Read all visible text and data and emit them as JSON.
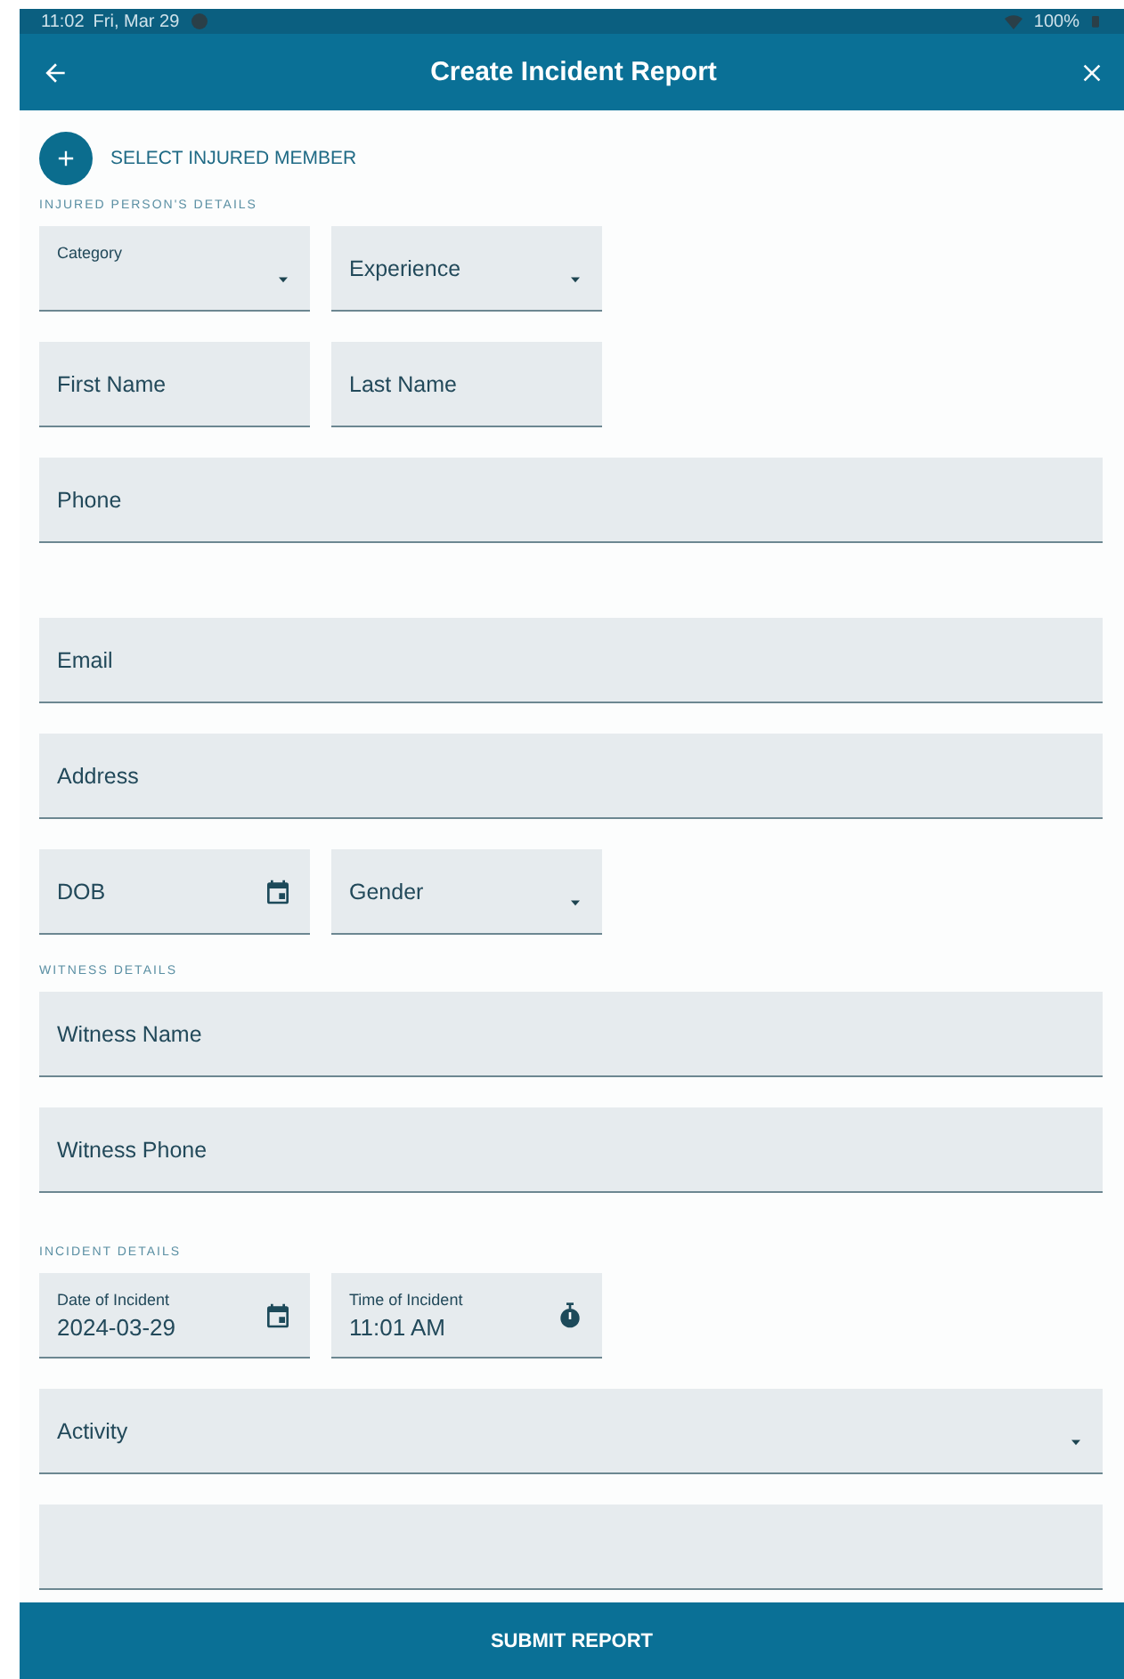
{
  "status_bar": {
    "time": "11:02",
    "date": "Fri, Mar 29",
    "battery": "100%"
  },
  "header": {
    "title": "Create Incident Report"
  },
  "select_member": {
    "label": "SELECT INJURED MEMBER"
  },
  "sections": [
    {
      "title": "INJURED PERSON'S DETAILS",
      "rows": [
        [
          {
            "kind": "dropdown",
            "label": "Category",
            "floated": true
          },
          {
            "kind": "dropdown",
            "label": "Experience",
            "floated": false
          }
        ],
        [
          {
            "kind": "text",
            "label": "First Name",
            "floated": false
          },
          {
            "kind": "text",
            "label": "Last Name",
            "floated": false
          }
        ],
        [
          {
            "kind": "text",
            "label": "Phone",
            "floated": false
          }
        ],
        [
          {
            "kind": "text",
            "label": "Email",
            "floated": false
          }
        ],
        [
          {
            "kind": "text",
            "label": "Address",
            "floated": false
          }
        ],
        [
          {
            "kind": "date",
            "label": "DOB",
            "floated": false
          },
          {
            "kind": "dropdown",
            "label": "Gender",
            "floated": false
          }
        ]
      ]
    },
    {
      "title": "WITNESS DETAILS",
      "rows": [
        [
          {
            "kind": "text",
            "label": "Witness Name",
            "floated": false
          }
        ],
        [
          {
            "kind": "text",
            "label": "Witness Phone",
            "floated": false
          }
        ]
      ]
    },
    {
      "title": "INCIDENT DETAILS",
      "rows": [
        [
          {
            "kind": "date",
            "label": "Date of Incident",
            "floated": true,
            "value": "2024-03-29"
          },
          {
            "kind": "time",
            "label": "Time of Incident",
            "floated": true,
            "value": "11:01 AM"
          }
        ],
        [
          {
            "kind": "dropdown",
            "label": "Activity",
            "floated": false
          }
        ],
        [
          {
            "kind": "text"
          }
        ]
      ]
    }
  ],
  "submit": {
    "label": "SUBMIT REPORT"
  }
}
